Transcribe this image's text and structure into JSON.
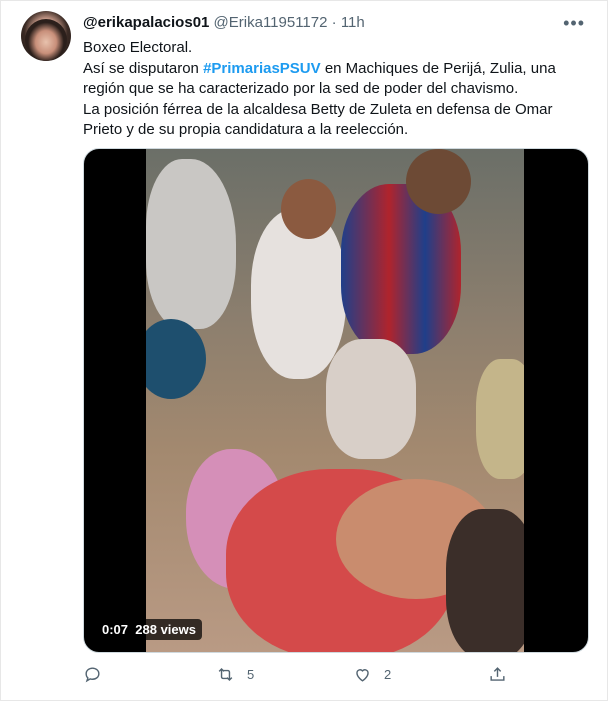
{
  "tweet": {
    "display_name": "@erikapalacios01",
    "handle": "@Erika11951172",
    "separator": "·",
    "time": "11h",
    "more_label": "•••",
    "text": {
      "line1": "Boxeo Electoral.",
      "line2_before": "Así se disputaron ",
      "hashtag": "#PrimariasPSUV",
      "line2_after": " en Machiques de Perijá, Zulia, una región que se ha caracterizado por la sed de poder del chavismo.",
      "line3": "La posición férrea de la alcaldesa Betty de Zuleta en defensa de Omar Prieto y de su propia candidatura a la reelección."
    },
    "media": {
      "duration": "0:07",
      "views": "288 views"
    },
    "actions": {
      "reply_count": "",
      "retweet_count": "5",
      "like_count": "2",
      "share_count": ""
    }
  },
  "colors": {
    "accent": "#1d9bf0",
    "secondary_text": "#536471"
  },
  "icons": [
    "more-icon",
    "reply-icon",
    "retweet-icon",
    "like-icon",
    "share-icon"
  ]
}
